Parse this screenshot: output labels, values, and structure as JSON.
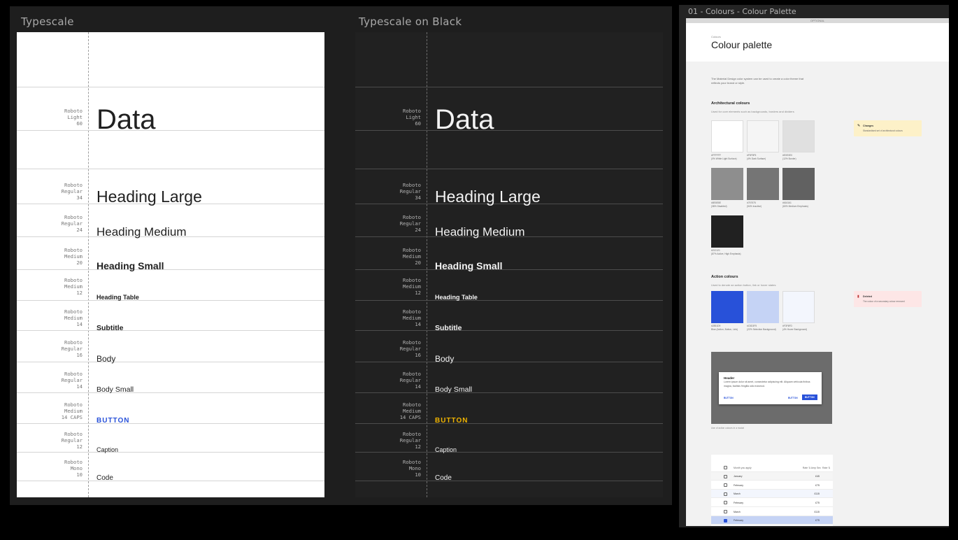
{
  "typescale": {
    "title": "Typescale",
    "dark_title": "Typescale on Black",
    "rows": [
      {
        "spec": "Roboto\nLight\n60",
        "sample": "Data"
      },
      {
        "spec": "Roboto\nRegular\n34",
        "sample": "Heading Large"
      },
      {
        "spec": "Roboto\nRegular\n24",
        "sample": "Heading Medium"
      },
      {
        "spec": "Roboto\nMedium\n20",
        "sample": "Heading Small"
      },
      {
        "spec": "Roboto\nMedium\n12",
        "sample": "Heading Table"
      },
      {
        "spec": "Roboto\nMedium\n14",
        "sample": "Subtitle"
      },
      {
        "spec": "Roboto\nRegular\n16",
        "sample": "Body"
      },
      {
        "spec": "Roboto\nRegular\n14",
        "sample": "Body Small"
      },
      {
        "spec": "Roboto\nMedium\n14 CAPS",
        "sample": "BUTTON"
      },
      {
        "spec": "Roboto\nRegular\n12",
        "sample": "Caption"
      },
      {
        "spec": "Roboto\nMono\n10",
        "sample": "Code"
      }
    ],
    "colors": {
      "light_button": "#2851d9",
      "dark_button": "#f0b400",
      "dark_bg": "#212121",
      "light_bg": "#ffffff"
    }
  },
  "palette": {
    "frame_title": "01 - Colours - Colour Palette",
    "topbar": "OPTIONAL",
    "breadcrumb": "Colours",
    "title": "Colour palette",
    "intro_1": "The Material Design color system can be used to create a color theme that",
    "intro_2": "reflects your brand or style.",
    "arch_heading": "Architectural colours",
    "arch_desc": "Used for core elements such as backgrounds, borders and dividers",
    "arch_swatches": [
      {
        "color": "#ffffff",
        "hex": "#FFFFFF",
        "label": "(0% White Light Surface)"
      },
      {
        "color": "#f5f5f5",
        "hex": "#F5F5F5",
        "label": "(4% Dark Surface)"
      },
      {
        "color": "#e0e0e0",
        "hex": "#E0E0E0",
        "label": "(12% Border)"
      },
      {
        "color": "#8e8e8e",
        "hex": "#8E8E8E",
        "label": "(38% Disabled)"
      },
      {
        "color": "#757575",
        "hex": "#757575",
        "label": "(54% Inactive)"
      },
      {
        "color": "#616161",
        "hex": "#616161",
        "label": "(60% Medium Emphasis)"
      },
      {
        "color": "#212121",
        "hex": "#212121",
        "label": "(87% Active, High Emphasis)"
      }
    ],
    "note_changes_title": "Changes",
    "note_changes_desc": "Standardised set of architectural colours",
    "action_heading": "Action colours",
    "action_desc": "Used to denote an action button, link or hover states",
    "action_swatches": [
      {
        "color": "#2851d9",
        "hex": "#2851D9",
        "label": "Blue (Action, Button, Link)"
      },
      {
        "color": "#c5d3f5",
        "hex": "#C5D3F5",
        "label": "(22% Selection Background)"
      },
      {
        "color": "#f3f6fd",
        "hex": "#F3F6FD",
        "label": "(4% Hover Background)"
      }
    ],
    "note_deleted_title": "Deleted",
    "note_deleted_desc": "The colour of a secondary colour removed",
    "modal": {
      "header": "Header",
      "body": "Lorem ipsum dolor sit amet, consectetur adipiscing elit. Aliquam vehicula finibus magna, facilisis fringilla odio euismod.",
      "btn1": "BUTTON",
      "btn2": "BUTTON",
      "btn3": "BUTTON",
      "caption": "Use of action colours in a modal"
    },
    "table": {
      "h1": "Month you apply",
      "h2": "Rate ⇅ Amp Sec",
      "h3": "Rate ⇅",
      "rows": [
        {
          "month": "January",
          "amount": "£45"
        },
        {
          "month": "February",
          "amount": "£75"
        },
        {
          "month": "March",
          "amount": "£115"
        },
        {
          "month": "February",
          "amount": "£75"
        },
        {
          "month": "March",
          "amount": "£115"
        },
        {
          "month": "February",
          "amount": "£75"
        }
      ]
    }
  }
}
